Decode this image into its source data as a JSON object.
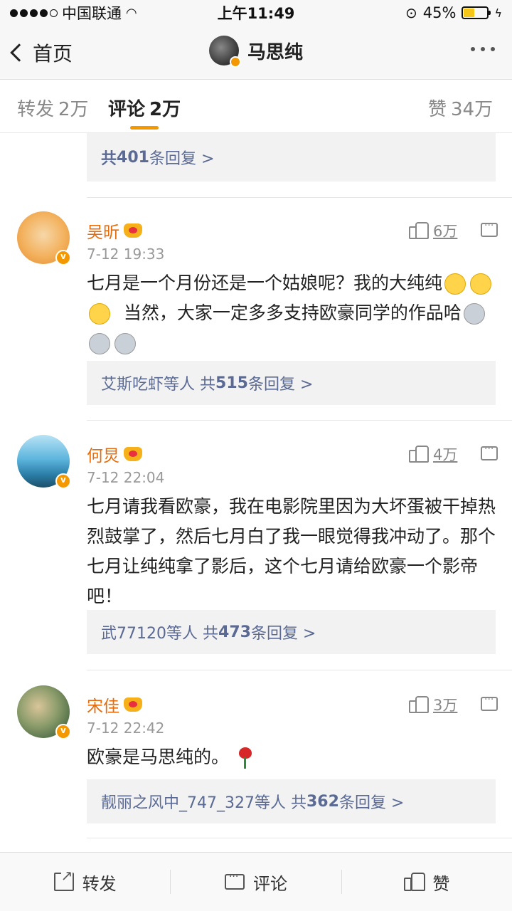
{
  "status_bar": {
    "carrier": "中国联通",
    "time": "上午11:49",
    "battery": "45%",
    "battery_level": 0.45
  },
  "nav": {
    "back_label": "首页",
    "title": "马思纯"
  },
  "tabs": {
    "repost_label": "转发",
    "repost_count": "2万",
    "comment_label": "评论",
    "comment_count": "2万",
    "like_label": "赞",
    "like_count": "34万"
  },
  "top_reply": {
    "prefix": "共",
    "count": "401",
    "suffix": "条回复 >"
  },
  "comments": [
    {
      "name": "吴昕",
      "time": "7-12 19:33",
      "likes": "6万",
      "text_a": "七月是一个月份还是一个姑娘呢？我的大纯纯",
      "text_b": "当然，大家一定多多支持欧豪同学的作品哈",
      "reply_users": "艾斯吃虾等人",
      "reply_prefix": "共",
      "reply_count": "515",
      "reply_suffix": "条回复 >"
    },
    {
      "name": "何炅",
      "time": "7-12 22:04",
      "likes": "4万",
      "text_a": "七月请我看欧豪，我在电影院里因为大坏蛋被干掉热烈鼓掌了，然后七月白了我一眼觉得我冲动了。那个七月让纯纯拿了影后，这个七月请给欧豪一个影帝吧！",
      "reply_users": "武77120等人",
      "reply_prefix": "共",
      "reply_count": "473",
      "reply_suffix": "条回复 >"
    },
    {
      "name": "宋佳",
      "time": "7-12 22:42",
      "likes": "3万",
      "text_a": "欧豪是马思纯的。",
      "reply_users": "靓丽之风中_747_327等人",
      "reply_prefix": "共",
      "reply_count": "362",
      "reply_suffix": "条回复 >"
    }
  ],
  "bottom_bar": {
    "repost": "转发",
    "comment": "评论",
    "like": "赞"
  },
  "colors": {
    "accent": "#f39800",
    "name": "#e86b0a",
    "link": "#5a6a94"
  }
}
